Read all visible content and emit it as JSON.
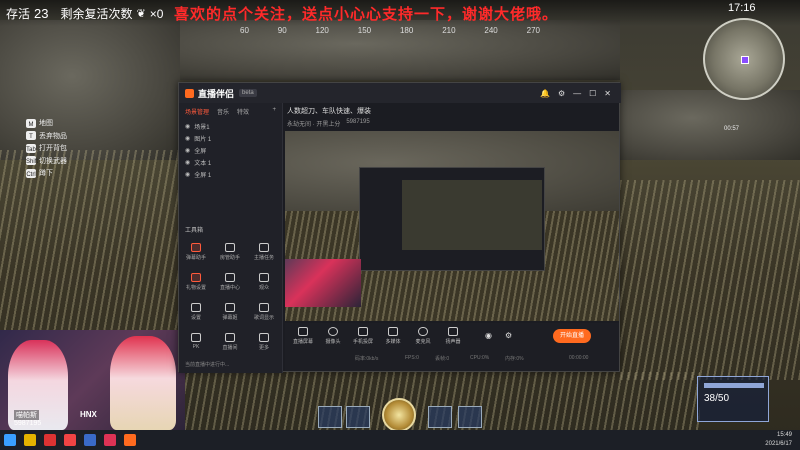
{
  "hud": {
    "survival_label": "存活",
    "survival_count": "23",
    "revive_label": "剩余复活次数",
    "revive_count": "×0",
    "banner": "喜欢的点个关注，送点小心心支持一下，谢谢大佬哦。",
    "compass_ticks": [
      "60",
      "90",
      "120",
      "150",
      "180",
      "210",
      "240",
      "270"
    ],
    "clock": "17:16",
    "keys": [
      {
        "key": "M",
        "label": "地图"
      },
      {
        "key": "T",
        "label": "丢弃物品"
      },
      {
        "key": "Tab",
        "label": "打开背包"
      },
      {
        "key": "Shift",
        "label": "切换武器"
      },
      {
        "key": "Ctrl",
        "label": "蹲下"
      }
    ],
    "hp": "38/50",
    "timer_small": "00:57"
  },
  "streamer": {
    "name": "喵帕斯",
    "id": "5987195",
    "tag": "HNX"
  },
  "app": {
    "title": "直播伴侣",
    "version_badge": "beta",
    "tabs": [
      "场景管理",
      "音乐",
      "特效"
    ],
    "active_tab": "场景管理",
    "add_label": "+",
    "sources": [
      {
        "label": "场景1",
        "visible": true
      },
      {
        "label": "图片 1",
        "visible": true
      },
      {
        "label": "全屏",
        "visible": true
      },
      {
        "label": "文本 1",
        "visible": true
      },
      {
        "label": "全屏 1",
        "visible": true
      }
    ],
    "tools_title": "工具箱",
    "tools": [
      "弹幕助手",
      "房管助手",
      "主播任务",
      "礼物设置",
      "直播中心",
      "观众",
      "设置",
      "弹幕姬",
      "歌词显示",
      "PK",
      "直播间",
      "更多"
    ],
    "stream_title": "人数超刀、车队快速、爆装",
    "stream_sub": "永劫无间 · 开黑上分",
    "room_id": "5987195",
    "bottom_tools": [
      "直播屏幕",
      "摄像头",
      "手机投屏",
      "多媒体",
      "麦克风",
      "扬声器"
    ],
    "go_live": "开始直播",
    "stats": [
      "码率:0kb/s",
      "FPS:0",
      "丢帧:0",
      "CPU:0%",
      "内存:0%",
      "00:00:00"
    ],
    "footer_note": "当前直播中进行中..."
  },
  "taskbar": {
    "time": "15:49",
    "date": "2021/6/17"
  },
  "colors": {
    "accent": "#ff6a1f",
    "banner_red": "#ff2a2a",
    "window_bg": "#1b1c22"
  }
}
